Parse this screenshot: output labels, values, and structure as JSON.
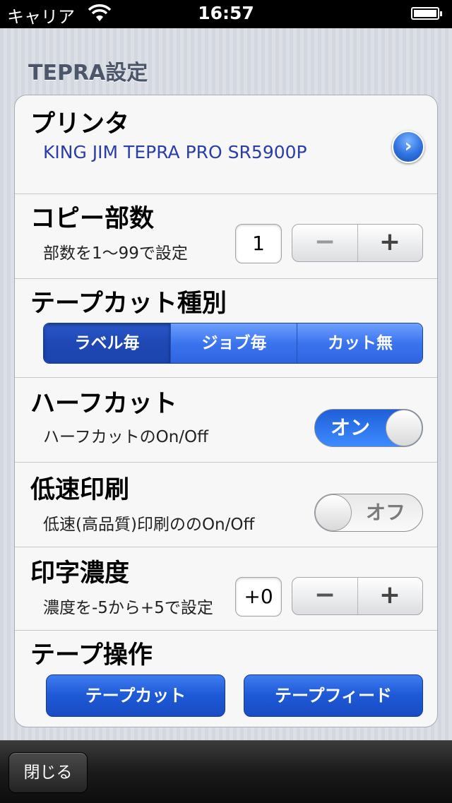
{
  "status_bar": {
    "carrier": "キャリア",
    "time": "16:57",
    "wifi_icon": "wifi-icon",
    "battery_icon": "battery-icon"
  },
  "section_title": "TEPRA設定",
  "printer": {
    "title": "プリンタ",
    "value": "KING JIM TEPRA PRO SR5900P",
    "disclosure_icon": "chevron-right-icon"
  },
  "copies": {
    "title": "コピー部数",
    "subtitle": "部数を1〜99で設定",
    "value": "1",
    "minus_label": "−",
    "plus_label": "+"
  },
  "tape_cut": {
    "title": "テープカット種別",
    "options": [
      "ラベル毎",
      "ジョブ毎",
      "カット無"
    ],
    "selected": "ラベル毎"
  },
  "half_cut": {
    "title": "ハーフカット",
    "subtitle": "ハーフカットのOn/Off",
    "state": "オン"
  },
  "low_speed": {
    "title": "低速印刷",
    "subtitle": "低速(高品質)印刷ののOn/Off",
    "state": "オフ"
  },
  "density": {
    "title": "印字濃度",
    "subtitle": "濃度を-5から+5で設定",
    "value": "+0",
    "minus_label": "−",
    "plus_label": "+"
  },
  "tape_ops": {
    "title": "テープ操作",
    "cut_label": "テープカット",
    "feed_label": "テープフィード"
  },
  "toolbar": {
    "close_label": "閉じる"
  },
  "colors": {
    "accent_blue": "#2f64e0",
    "printer_text": "#2a3eaa",
    "toolbar_dark": "#1a1a1a"
  }
}
